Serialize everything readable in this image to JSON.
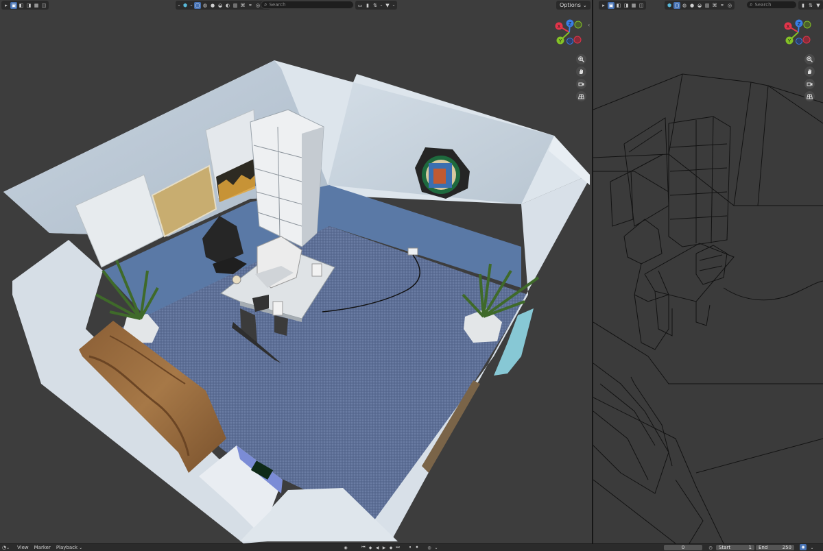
{
  "viewports": {
    "left": {
      "shading": "Material Preview",
      "search_placeholder": "Search",
      "options_label": "Options",
      "gizmo": {
        "x": "X",
        "y": "Y",
        "z": "Z"
      }
    },
    "right": {
      "shading": "Wireframe",
      "search_placeholder": "Search",
      "gizmo": {
        "x": "X",
        "y": "Y",
        "z": "Z"
      }
    }
  },
  "nav_icons": [
    "zoom-icon",
    "hand-pan-icon",
    "camera-icon",
    "grid-perspective-icon"
  ],
  "timeline": {
    "menus": [
      "View",
      "Marker",
      "Playback"
    ],
    "current_frame": "0",
    "start_label": "Start",
    "start_value": "1",
    "end_label": "End",
    "end_value": "250"
  },
  "colors": {
    "accent": "#4772b3",
    "axis_x": "#e3344a",
    "axis_y": "#84c226",
    "axis_z": "#3a7ee6",
    "viewport_bg": "#3d3d3d"
  }
}
